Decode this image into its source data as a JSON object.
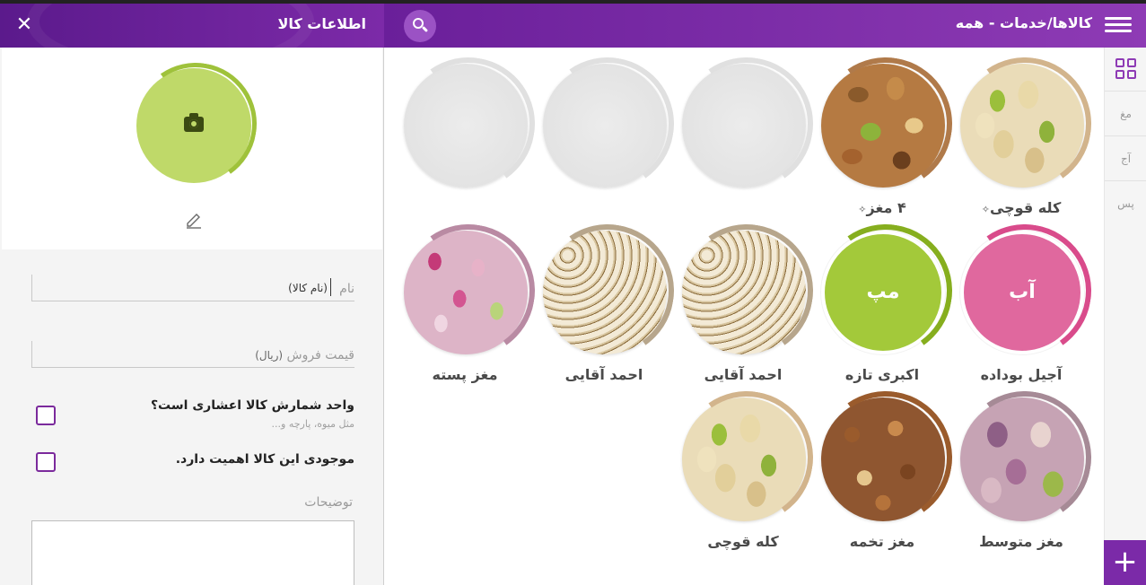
{
  "left_panel": {
    "title": "اطلاعات کالا",
    "close_symbol": "✕",
    "avatar_ring_color": "#9fc23b",
    "avatar_color": "#bfd969",
    "form": {
      "name_label": "نام",
      "name_value": "(نام کالا)",
      "price_label": "قیمت فروش",
      "price_unit": "(ریال)",
      "decimal_question": "واحد شمارش کالا اعشاری است؟",
      "decimal_hint": "مثل میوه، پارچه و...",
      "stock_question": "موجودی این کالا اهمیت دارد.",
      "description_label": "توضیحات"
    }
  },
  "main": {
    "title": "کالاها/خدمات - همه",
    "accent": "#7b2aa8",
    "side_tabs": [
      "مغ",
      "آج",
      "پس"
    ],
    "add_symbol": "+",
    "items": [
      {
        "name": "کله قوچی",
        "pinned": true,
        "type": "image",
        "texture": "tex-pistachio",
        "ring": "#d2b48c"
      },
      {
        "name": "۴ مغز",
        "pinned": true,
        "type": "image",
        "texture": "tex-mixed",
        "ring": "#b07a4a"
      },
      {
        "name": "",
        "pinned": false,
        "type": "empty",
        "ring": "#e0e0e0"
      },
      {
        "name": "",
        "pinned": false,
        "type": "empty",
        "ring": "#e0e0e0"
      },
      {
        "name": "",
        "pinned": false,
        "type": "empty",
        "ring": "#e0e0e0"
      },
      {
        "name": "آجیل بوداده",
        "pinned": false,
        "type": "text",
        "abbr": "آب",
        "color": "#e0689e",
        "ring": "#d94b8b"
      },
      {
        "name": "اکبری تازه",
        "pinned": false,
        "type": "text",
        "abbr": "مپ",
        "color": "#a3c93a",
        "ring": "#86ae1e"
      },
      {
        "name": "احمد آقایی",
        "pinned": false,
        "type": "image",
        "texture": "tex-shelled",
        "ring": "#b7a68c"
      },
      {
        "name": "احمد آقایی",
        "pinned": false,
        "type": "image",
        "texture": "tex-shelled",
        "ring": "#b7a68c"
      },
      {
        "name": "مغز پسته",
        "pinned": false,
        "type": "image",
        "texture": "tex-pink",
        "ring": "#b98aa3"
      },
      {
        "name": "مغز متوسط",
        "pinned": false,
        "type": "image",
        "texture": "tex-medium",
        "ring": "#a68a96"
      },
      {
        "name": "مغز تخمه",
        "pinned": false,
        "type": "image",
        "texture": "tex-hazel",
        "ring": "#9a5b2c"
      },
      {
        "name": "کله قوچی",
        "pinned": false,
        "type": "image",
        "texture": "tex-pistachio",
        "ring": "#d2b48c"
      }
    ]
  }
}
